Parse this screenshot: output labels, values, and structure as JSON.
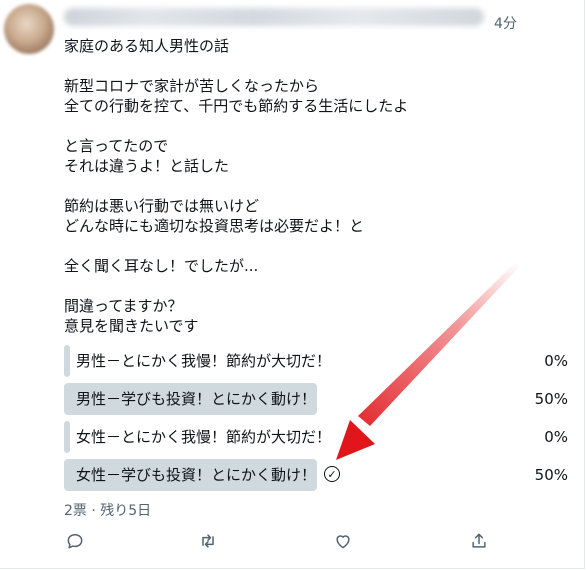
{
  "tweet": {
    "time": "4分",
    "body_lines": [
      "家庭のある知人男性の話",
      "",
      "新型コロナで家計が苦しくなったから",
      "全ての行動を控て、千円でも節約する生活にしたよ",
      "",
      "と言ってたので",
      "それは違うよ！と話した",
      "",
      "節約は悪い行動では無いけど",
      "どんな時にも適切な投資思考は必要だよ！と",
      "",
      "全く聞く耳なし！でしたが...",
      "",
      "間違ってますか？",
      "意見を聞きたいです"
    ]
  },
  "poll": {
    "options": [
      {
        "label": "男性－とにかく我慢！節約が大切だ！",
        "percent_text": "0%",
        "percent": 0,
        "selected": false
      },
      {
        "label": "男性－学びも投資！とにかく動け！",
        "percent_text": "50%",
        "percent": 50,
        "selected": false
      },
      {
        "label": "女性－とにかく我慢！節約が大切だ！",
        "percent_text": "0%",
        "percent": 0,
        "selected": false
      },
      {
        "label": "女性－学びも投資！とにかく動け！",
        "percent_text": "50%",
        "percent": 50,
        "selected": true
      }
    ],
    "summary": "2票 · 残り5日"
  },
  "actions": {
    "icons": [
      "reply-icon",
      "retweet-icon",
      "like-icon",
      "share-icon"
    ]
  },
  "colors": {
    "bar": "#cfd9de",
    "text": "#0f1419",
    "muted": "#536471",
    "arrow": "#e0161b"
  }
}
